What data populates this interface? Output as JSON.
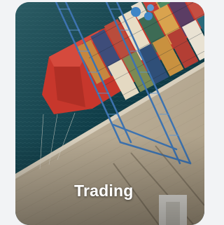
{
  "card": {
    "label": "Trading",
    "image_icon": "container-ship-port-photo"
  },
  "colors": {
    "sea": "#0f3d48",
    "hull": "#c7372c",
    "dock": "#b9ad97",
    "crane": "#3d73b0",
    "label_text": "#ffffff"
  }
}
